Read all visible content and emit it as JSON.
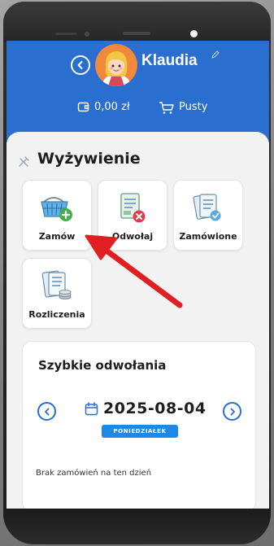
{
  "header": {
    "username": "Klaudia",
    "balance": "0,00 zł",
    "cart_status": "Pusty",
    "color": "#2a6fcf"
  },
  "section": {
    "title": "Wyżywienie",
    "icon": "cutlery-icon"
  },
  "tiles": [
    {
      "label": "Zamów",
      "icon": "basket-add-icon"
    },
    {
      "label": "Odwołaj",
      "icon": "document-cancel-icon"
    },
    {
      "label": "Zamówione",
      "icon": "document-check-icon"
    },
    {
      "label": "Rozliczenia",
      "icon": "billing-icon"
    }
  ],
  "quick_cancel": {
    "title": "Szybkie odwołania",
    "date": "2025-08-04",
    "day": "PONIEDZIAŁEK",
    "empty_message": "Brak zamówień na ten dzień"
  },
  "colors": {
    "accent": "#2a6fcf",
    "badge": "#1e88e5",
    "annotation_arrow": "#e02020"
  }
}
